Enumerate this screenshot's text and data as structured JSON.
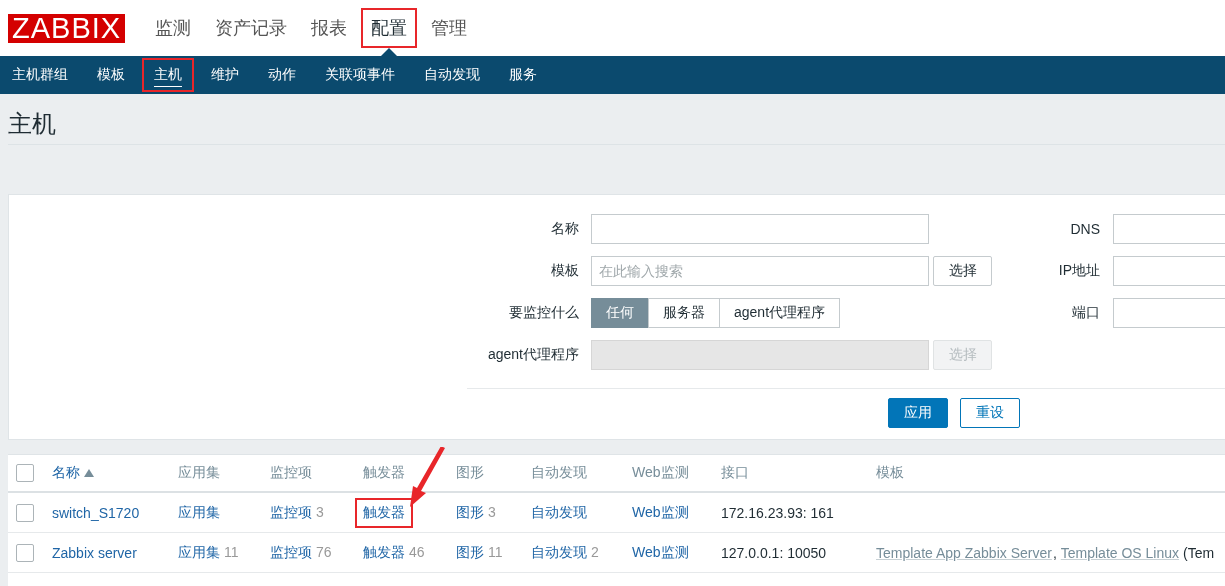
{
  "logo": "ZABBIX",
  "top_menu": [
    {
      "label": "监测",
      "selected": false,
      "highlighted": false
    },
    {
      "label": "资产记录",
      "selected": false,
      "highlighted": false
    },
    {
      "label": "报表",
      "selected": false,
      "highlighted": false
    },
    {
      "label": "配置",
      "selected": true,
      "highlighted": true
    },
    {
      "label": "管理",
      "selected": false,
      "highlighted": false
    }
  ],
  "sub_menu": [
    {
      "label": "主机群组",
      "selected": false,
      "highlighted": false
    },
    {
      "label": "模板",
      "selected": false,
      "highlighted": false
    },
    {
      "label": "主机",
      "selected": true,
      "highlighted": true
    },
    {
      "label": "维护",
      "selected": false,
      "highlighted": false
    },
    {
      "label": "动作",
      "selected": false,
      "highlighted": false
    },
    {
      "label": "关联项事件",
      "selected": false,
      "highlighted": false
    },
    {
      "label": "自动发现",
      "selected": false,
      "highlighted": false
    },
    {
      "label": "服务",
      "selected": false,
      "highlighted": false
    }
  ],
  "page_title": "主机",
  "filter": {
    "left": [
      {
        "kind": "input",
        "label": "名称"
      },
      {
        "kind": "input_button",
        "label": "模板",
        "placeholder": "在此输入搜索",
        "button": "选择",
        "disabled": false
      },
      {
        "kind": "segmented",
        "label": "要监控什么",
        "options": [
          {
            "label": "任何",
            "selected": true
          },
          {
            "label": "服务器",
            "selected": false
          },
          {
            "label": "agent代理程序",
            "selected": false
          }
        ]
      },
      {
        "kind": "input_button",
        "label": "agent代理程序",
        "button": "选择",
        "disabled": true
      }
    ],
    "right": [
      {
        "label": "DNS"
      },
      {
        "label": "IP地址"
      },
      {
        "label": "端口"
      }
    ],
    "apply": "应用",
    "reset": "重设"
  },
  "table": {
    "columns": [
      {
        "label": "名称",
        "sorted": true
      },
      {
        "label": "应用集",
        "sorted": false
      },
      {
        "label": "监控项",
        "sorted": false
      },
      {
        "label": "触发器",
        "sorted": false
      },
      {
        "label": "图形",
        "sorted": false
      },
      {
        "label": "自动发现",
        "sorted": false
      },
      {
        "label": "Web监测",
        "sorted": false
      },
      {
        "label": "接口",
        "sorted": false
      },
      {
        "label": "模板",
        "sorted": false
      }
    ],
    "all_checked": false,
    "rows": [
      {
        "checked": false,
        "name": "switch_S1720",
        "applications": {
          "label": "应用集",
          "highlighted": false
        },
        "items": {
          "label": "监控项",
          "count": "3",
          "highlighted": false
        },
        "triggers": {
          "label": "触发器",
          "highlighted": true
        },
        "graphs": {
          "label": "图形",
          "count": "3",
          "highlighted": false
        },
        "discovery": {
          "label": "自动发现",
          "highlighted": false
        },
        "web": {
          "label": "Web监测",
          "highlighted": false
        },
        "interface": "172.16.23.93: 161"
      },
      {
        "checked": false,
        "name": "Zabbix server",
        "applications": {
          "label": "应用集",
          "count": "11",
          "highlighted": false
        },
        "items": {
          "label": "监控项",
          "count": "76",
          "highlighted": false
        },
        "triggers": {
          "label": "触发器",
          "count": "46",
          "highlighted": false
        },
        "graphs": {
          "label": "图形",
          "count": "11",
          "highlighted": false
        },
        "discovery": {
          "label": "自动发现",
          "count": "2",
          "highlighted": false
        },
        "web": {
          "label": "Web监测",
          "highlighted": false
        },
        "interface": "127.0.0.1: 10050",
        "templates": [
          {
            "name": "Template App Zabbix Server",
            "after": ","
          },
          {
            "name": "Template OS Linux",
            "after": "(Tem"
          }
        ]
      }
    ]
  }
}
